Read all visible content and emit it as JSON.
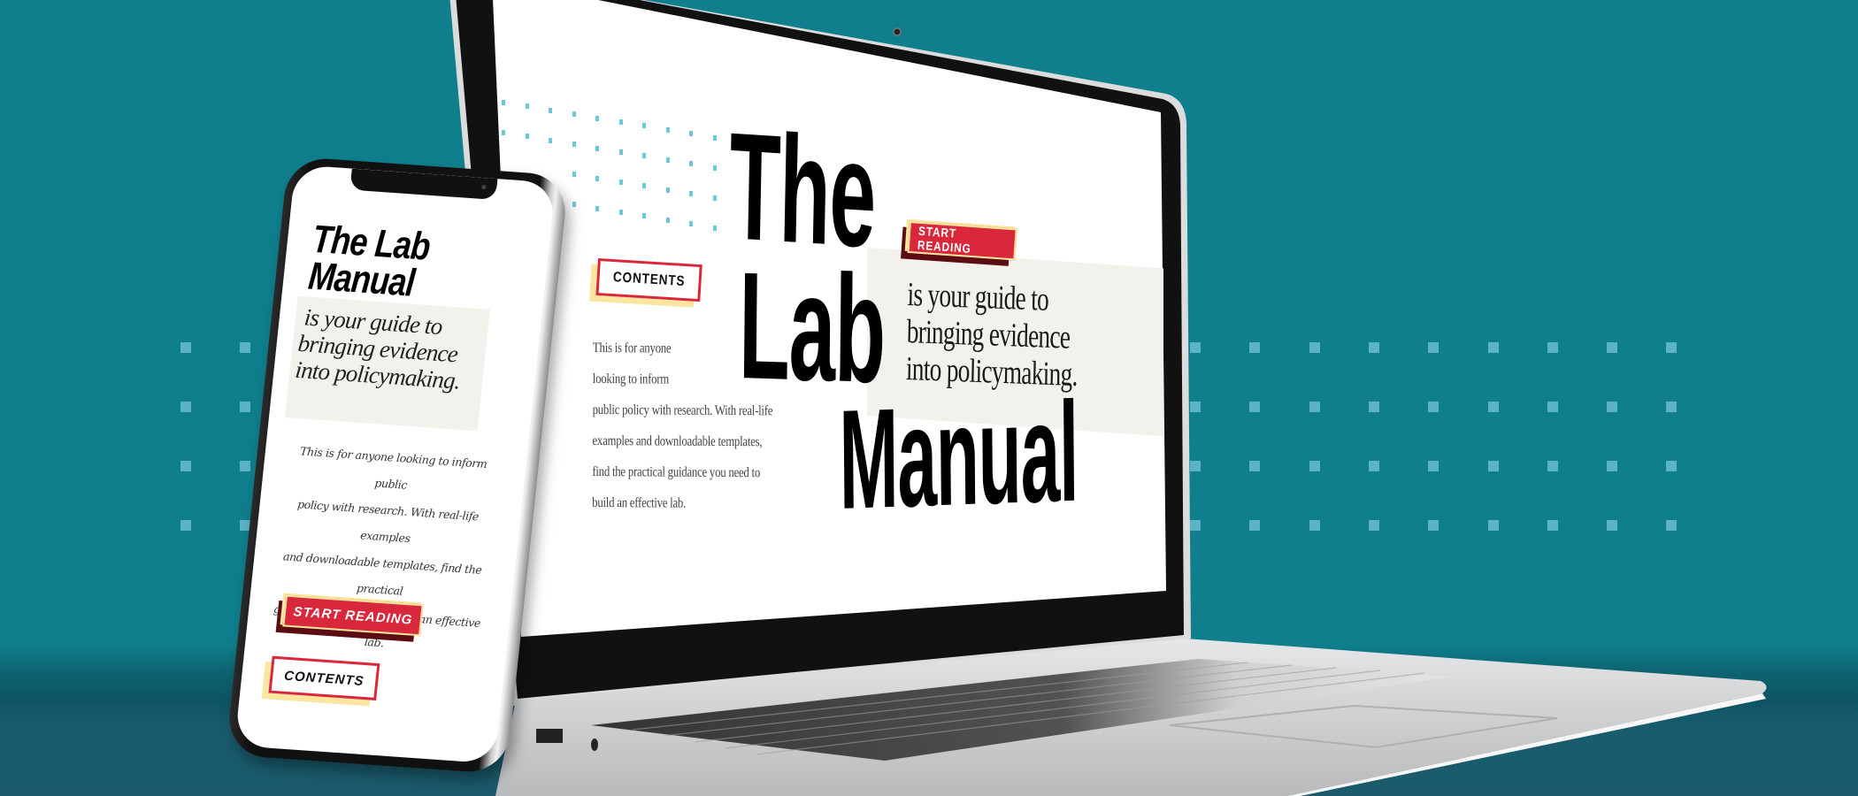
{
  "scene": {
    "description": "The Lab Manual landing page shown on a laptop and a phone",
    "colors": {
      "background": "#0f7f8e",
      "accent_red": "#d9283b",
      "accent_maroon": "#5c0d14",
      "accent_yellow": "#fbe6a0",
      "band_beige": "#f3f1ec",
      "dot_blue": "#5db3c6"
    }
  },
  "laptop": {
    "title_lines": [
      "The",
      "Lab",
      "Manual"
    ],
    "start_button": "START READING",
    "contents_button": "CONTENTS",
    "tagline_lines": [
      "is your guide to",
      "bringing evidence",
      "into policymaking."
    ],
    "paragraph_lines": [
      "This is for anyone",
      "looking to inform",
      "public policy with research. With real-life",
      "examples and downloadable templates,",
      "find the practical guidance you need to",
      "build an effective lab."
    ],
    "camera_icon": "webcam-icon"
  },
  "phone": {
    "title_lines": [
      "The Lab",
      "Manual"
    ],
    "tagline_lines": [
      "is your guide to",
      "bringing evidence",
      "into policymaking."
    ],
    "paragraph_lines": [
      "This is for anyone looking to inform public",
      "policy with research. With real-life examples",
      "and downloadable templates, find the practical",
      "guidance you need to build an effective lab."
    ],
    "start_button": "START READING",
    "contents_button": "CONTENTS"
  }
}
